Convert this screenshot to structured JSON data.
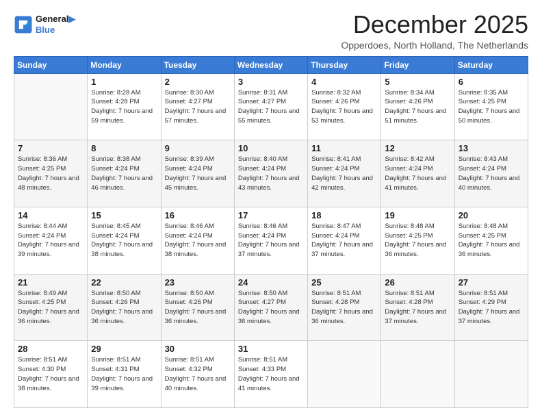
{
  "logo": {
    "line1": "General",
    "line2": "Blue"
  },
  "title": "December 2025",
  "location": "Opperdoes, North Holland, The Netherlands",
  "days_header": [
    "Sunday",
    "Monday",
    "Tuesday",
    "Wednesday",
    "Thursday",
    "Friday",
    "Saturday"
  ],
  "weeks": [
    [
      {
        "num": "",
        "info": ""
      },
      {
        "num": "1",
        "info": "Sunrise: 8:28 AM\nSunset: 4:28 PM\nDaylight: 7 hours\nand 59 minutes."
      },
      {
        "num": "2",
        "info": "Sunrise: 8:30 AM\nSunset: 4:27 PM\nDaylight: 7 hours\nand 57 minutes."
      },
      {
        "num": "3",
        "info": "Sunrise: 8:31 AM\nSunset: 4:27 PM\nDaylight: 7 hours\nand 55 minutes."
      },
      {
        "num": "4",
        "info": "Sunrise: 8:32 AM\nSunset: 4:26 PM\nDaylight: 7 hours\nand 53 minutes."
      },
      {
        "num": "5",
        "info": "Sunrise: 8:34 AM\nSunset: 4:26 PM\nDaylight: 7 hours\nand 51 minutes."
      },
      {
        "num": "6",
        "info": "Sunrise: 8:35 AM\nSunset: 4:25 PM\nDaylight: 7 hours\nand 50 minutes."
      }
    ],
    [
      {
        "num": "7",
        "info": "Sunrise: 8:36 AM\nSunset: 4:25 PM\nDaylight: 7 hours\nand 48 minutes."
      },
      {
        "num": "8",
        "info": "Sunrise: 8:38 AM\nSunset: 4:24 PM\nDaylight: 7 hours\nand 46 minutes."
      },
      {
        "num": "9",
        "info": "Sunrise: 8:39 AM\nSunset: 4:24 PM\nDaylight: 7 hours\nand 45 minutes."
      },
      {
        "num": "10",
        "info": "Sunrise: 8:40 AM\nSunset: 4:24 PM\nDaylight: 7 hours\nand 43 minutes."
      },
      {
        "num": "11",
        "info": "Sunrise: 8:41 AM\nSunset: 4:24 PM\nDaylight: 7 hours\nand 42 minutes."
      },
      {
        "num": "12",
        "info": "Sunrise: 8:42 AM\nSunset: 4:24 PM\nDaylight: 7 hours\nand 41 minutes."
      },
      {
        "num": "13",
        "info": "Sunrise: 8:43 AM\nSunset: 4:24 PM\nDaylight: 7 hours\nand 40 minutes."
      }
    ],
    [
      {
        "num": "14",
        "info": "Sunrise: 8:44 AM\nSunset: 4:24 PM\nDaylight: 7 hours\nand 39 minutes."
      },
      {
        "num": "15",
        "info": "Sunrise: 8:45 AM\nSunset: 4:24 PM\nDaylight: 7 hours\nand 38 minutes."
      },
      {
        "num": "16",
        "info": "Sunrise: 8:46 AM\nSunset: 4:24 PM\nDaylight: 7 hours\nand 38 minutes."
      },
      {
        "num": "17",
        "info": "Sunrise: 8:46 AM\nSunset: 4:24 PM\nDaylight: 7 hours\nand 37 minutes."
      },
      {
        "num": "18",
        "info": "Sunrise: 8:47 AM\nSunset: 4:24 PM\nDaylight: 7 hours\nand 37 minutes."
      },
      {
        "num": "19",
        "info": "Sunrise: 8:48 AM\nSunset: 4:25 PM\nDaylight: 7 hours\nand 36 minutes."
      },
      {
        "num": "20",
        "info": "Sunrise: 8:48 AM\nSunset: 4:25 PM\nDaylight: 7 hours\nand 36 minutes."
      }
    ],
    [
      {
        "num": "21",
        "info": "Sunrise: 8:49 AM\nSunset: 4:25 PM\nDaylight: 7 hours\nand 36 minutes."
      },
      {
        "num": "22",
        "info": "Sunrise: 8:50 AM\nSunset: 4:26 PM\nDaylight: 7 hours\nand 36 minutes."
      },
      {
        "num": "23",
        "info": "Sunrise: 8:50 AM\nSunset: 4:26 PM\nDaylight: 7 hours\nand 36 minutes."
      },
      {
        "num": "24",
        "info": "Sunrise: 8:50 AM\nSunset: 4:27 PM\nDaylight: 7 hours\nand 36 minutes."
      },
      {
        "num": "25",
        "info": "Sunrise: 8:51 AM\nSunset: 4:28 PM\nDaylight: 7 hours\nand 36 minutes."
      },
      {
        "num": "26",
        "info": "Sunrise: 8:51 AM\nSunset: 4:28 PM\nDaylight: 7 hours\nand 37 minutes."
      },
      {
        "num": "27",
        "info": "Sunrise: 8:51 AM\nSunset: 4:29 PM\nDaylight: 7 hours\nand 37 minutes."
      }
    ],
    [
      {
        "num": "28",
        "info": "Sunrise: 8:51 AM\nSunset: 4:30 PM\nDaylight: 7 hours\nand 38 minutes."
      },
      {
        "num": "29",
        "info": "Sunrise: 8:51 AM\nSunset: 4:31 PM\nDaylight: 7 hours\nand 39 minutes."
      },
      {
        "num": "30",
        "info": "Sunrise: 8:51 AM\nSunset: 4:32 PM\nDaylight: 7 hours\nand 40 minutes."
      },
      {
        "num": "31",
        "info": "Sunrise: 8:51 AM\nSunset: 4:33 PM\nDaylight: 7 hours\nand 41 minutes."
      },
      {
        "num": "",
        "info": ""
      },
      {
        "num": "",
        "info": ""
      },
      {
        "num": "",
        "info": ""
      }
    ]
  ]
}
